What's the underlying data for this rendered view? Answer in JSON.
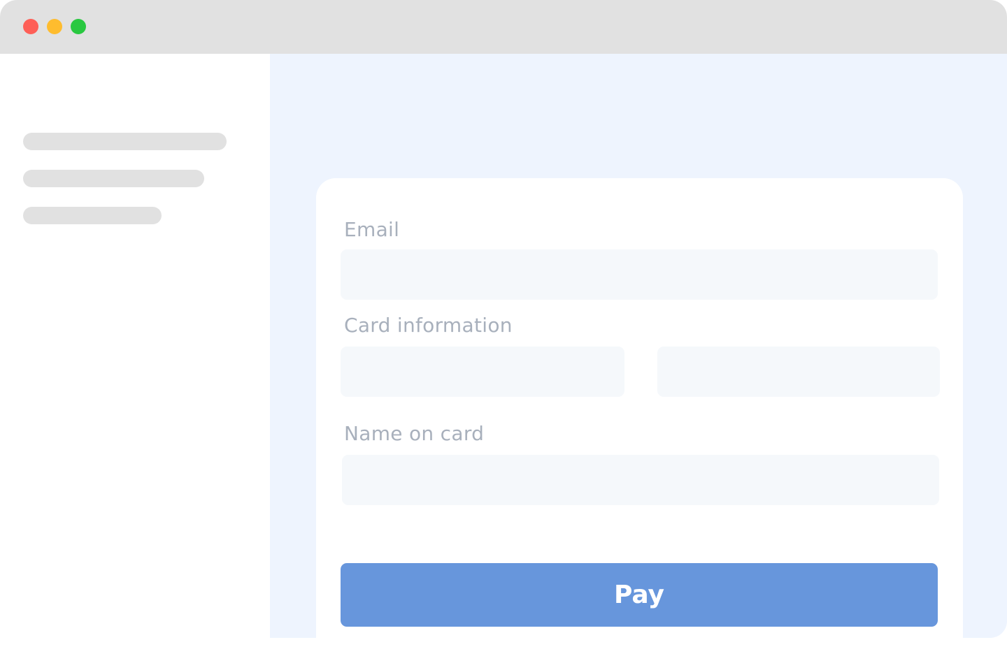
{
  "window": {
    "controls": {
      "close_color": "#fe5f57",
      "minimize_color": "#febc2e",
      "maximize_color": "#29c840"
    }
  },
  "form": {
    "email_label": "Email",
    "email_value": "",
    "card_label": "Card information",
    "card_number_value": "",
    "card_extra_value": "",
    "name_label": "Name on card",
    "name_value": "",
    "pay_label": "Pay"
  },
  "colors": {
    "accent": "#6796dc",
    "main_background": "#eef4fe",
    "field_background": "#f5f8fb",
    "label_text": "#a8b0bc",
    "skeleton": "#e1e1e1"
  }
}
